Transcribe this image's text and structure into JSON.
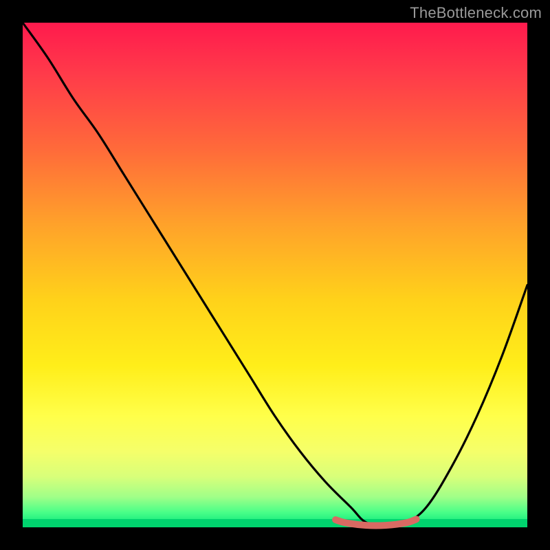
{
  "watermark": "TheBottleneck.com",
  "colors": {
    "frame": "#000000",
    "watermark_text": "#9a9a9a",
    "gradient_top": "#ff1a4d",
    "gradient_bottom": "#00e27a",
    "curve": "#000000",
    "valley_highlight": "#d96a63"
  },
  "chart_data": {
    "type": "line",
    "title": "",
    "xlabel": "",
    "ylabel": "",
    "xlim": [
      0,
      100
    ],
    "ylim": [
      0,
      100
    ],
    "grid": false,
    "legend": false,
    "background": "vertical red-to-green gradient (red high, green low)",
    "annotations": [
      {
        "text": "TheBottleneck.com",
        "position": "top-right"
      }
    ],
    "series": [
      {
        "name": "bottleneck-curve",
        "color": "#000000",
        "x": [
          0,
          5,
          10,
          15,
          20,
          25,
          30,
          35,
          40,
          45,
          50,
          55,
          60,
          65,
          68,
          72,
          76,
          80,
          85,
          90,
          95,
          100
        ],
        "y": [
          100,
          93,
          85,
          78,
          70,
          62,
          54,
          46,
          38,
          30,
          22,
          15,
          9,
          4,
          1,
          0,
          1,
          4,
          12,
          22,
          34,
          48
        ]
      },
      {
        "name": "valley-highlight",
        "color": "#d96a63",
        "x": [
          62,
          64,
          68,
          72,
          76,
          78
        ],
        "y": [
          1.5,
          0.9,
          0.4,
          0.4,
          0.9,
          1.6
        ]
      }
    ]
  }
}
